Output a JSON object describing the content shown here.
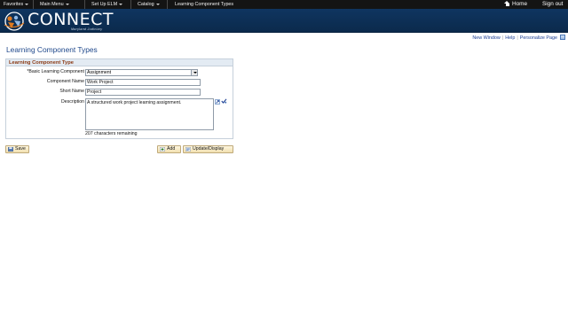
{
  "nav": {
    "items": [
      {
        "label": "Favorites",
        "has_menu": true
      },
      {
        "label": "Main Menu",
        "has_menu": true
      },
      {
        "label": "Set Up ELM",
        "has_menu": true
      },
      {
        "label": "Catalog",
        "has_menu": true
      },
      {
        "label": "Learning Component Types",
        "has_menu": false
      }
    ],
    "home_label": "Home",
    "signout_label": "Sign out"
  },
  "brand": {
    "name": "CONNECT",
    "tagline": "Maryland Judiciary",
    "banner_color": "#0f3560"
  },
  "pagebar": {
    "new_window": "New Window",
    "help": "Help",
    "personalize": "Personalize Page"
  },
  "page": {
    "title": "Learning Component Types"
  },
  "form": {
    "section_title": "Learning Component Type",
    "basic_component_label": "*Basic Learning Component",
    "basic_component_value": "Assignment",
    "component_name_label": "Component Name",
    "component_name_value": "Work Project",
    "short_name_label": "Short Name",
    "short_name_value": "Project",
    "description_label": "Description",
    "description_value": "A structured work project learning assignment.",
    "chars_remaining": "207 characters remaining"
  },
  "buttons": {
    "save": "Save",
    "add": "Add",
    "update_display": "Update/Display"
  },
  "colors": {
    "section_title": "#8b3a15",
    "page_title": "#20498c",
    "link": "#1c3f94"
  },
  "icons": [
    "home-icon",
    "expand-icon",
    "spell-check-icon",
    "save-icon",
    "add-icon",
    "update-display-icon",
    "customize-grid-icon"
  ]
}
